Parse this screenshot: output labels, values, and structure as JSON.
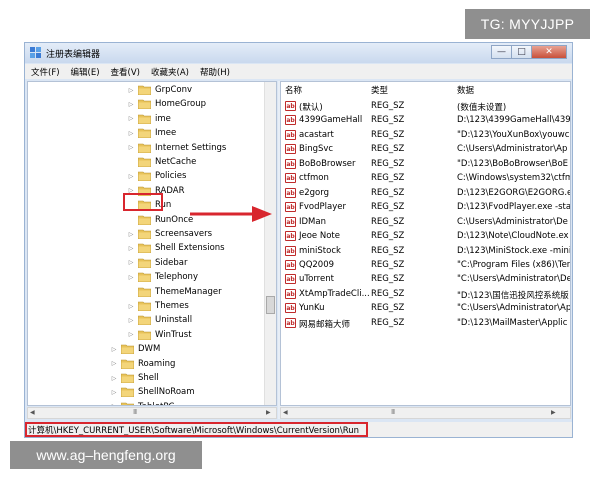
{
  "watermark_top": "TG: MYYJJPP",
  "watermark_bottom": "www.ag–hengfeng.org",
  "window": {
    "title": "注册表编辑器",
    "buttons": {
      "minimize": "—",
      "maximize": "□",
      "close": "✕"
    }
  },
  "menu": [
    "文件(F)",
    "编辑(E)",
    "查看(V)",
    "收藏夹(A)",
    "帮助(H)"
  ],
  "tree": [
    {
      "label": "GrpConv",
      "expandable": true
    },
    {
      "label": "HomeGroup",
      "expandable": true
    },
    {
      "label": "ime",
      "expandable": true
    },
    {
      "label": "Imee",
      "expandable": true
    },
    {
      "label": "Internet Settings",
      "expandable": true
    },
    {
      "label": "NetCache",
      "expandable": false
    },
    {
      "label": "Policies",
      "expandable": true
    },
    {
      "label": "RADAR",
      "expandable": true
    },
    {
      "label": "Run",
      "expandable": false,
      "selected": true
    },
    {
      "label": "RunOnce",
      "expandable": false
    },
    {
      "label": "Screensavers",
      "expandable": true
    },
    {
      "label": "Shell Extensions",
      "expandable": true
    },
    {
      "label": "Sidebar",
      "expandable": true
    },
    {
      "label": "Telephony",
      "expandable": true
    },
    {
      "label": "ThemeManager",
      "expandable": false
    },
    {
      "label": "Themes",
      "expandable": true
    },
    {
      "label": "Uninstall",
      "expandable": true
    },
    {
      "label": "WinTrust",
      "expandable": true
    },
    {
      "label": "DWM",
      "expandable": true
    },
    {
      "label": "Roaming",
      "expandable": true
    },
    {
      "label": "Shell",
      "expandable": true
    },
    {
      "label": "ShellNoRoam",
      "expandable": true
    },
    {
      "label": "TabletPC",
      "expandable": true
    }
  ],
  "columns": {
    "name": "名称",
    "type": "类型",
    "data": "数据"
  },
  "values": [
    {
      "name": "(默认)",
      "type": "REG_SZ",
      "data": "(数值未设置)"
    },
    {
      "name": "4399GameHall",
      "type": "REG_SZ",
      "data": "D:\\123\\4399GameHall\\4399"
    },
    {
      "name": "acastart",
      "type": "REG_SZ",
      "data": "\"D:\\123\\YouXunBox\\youwc"
    },
    {
      "name": "BingSvc",
      "type": "REG_SZ",
      "data": "C:\\Users\\Administrator\\Ap"
    },
    {
      "name": "BoBoBrowser",
      "type": "REG_SZ",
      "data": "\"D:\\123\\BoBoBrowser\\BoE"
    },
    {
      "name": "ctfmon",
      "type": "REG_SZ",
      "data": "C:\\Windows\\system32\\ctfm"
    },
    {
      "name": "e2gorg",
      "type": "REG_SZ",
      "data": "D:\\123\\E2GORG\\E2GORG.e"
    },
    {
      "name": "FvodPlayer",
      "type": "REG_SZ",
      "data": "D:\\123\\FvodPlayer.exe -sta"
    },
    {
      "name": "IDMan",
      "type": "REG_SZ",
      "data": "C:\\Users\\Administrator\\De"
    },
    {
      "name": "Jeoe Note",
      "type": "REG_SZ",
      "data": "D:\\123\\Note\\CloudNote.ex"
    },
    {
      "name": "miniStock",
      "type": "REG_SZ",
      "data": "D:\\123\\MiniStock.exe -mini"
    },
    {
      "name": "QQ2009",
      "type": "REG_SZ",
      "data": "\"C:\\Program Files (x86)\\Ter"
    },
    {
      "name": "uTorrent",
      "type": "REG_SZ",
      "data": "\"C:\\Users\\Administrator\\De"
    },
    {
      "name": "XtAmpTradeCli...",
      "type": "REG_SZ",
      "data": "\"D:\\123\\国信迅投风控系统版"
    },
    {
      "name": "YunKu",
      "type": "REG_SZ",
      "data": "\"C:\\Users\\Administrator\\Ap"
    },
    {
      "name": "网易邮箱大师",
      "type": "REG_SZ",
      "data": "\"D:\\123\\MailMaster\\Applic"
    }
  ],
  "status_path": "计算机\\HKEY_CURRENT_USER\\Software\\Microsoft\\Windows\\CurrentVersion\\Run",
  "colors": {
    "highlight": "#d8262e",
    "folder": "#e8c35a",
    "reg_icon": "#bf2b2b"
  }
}
